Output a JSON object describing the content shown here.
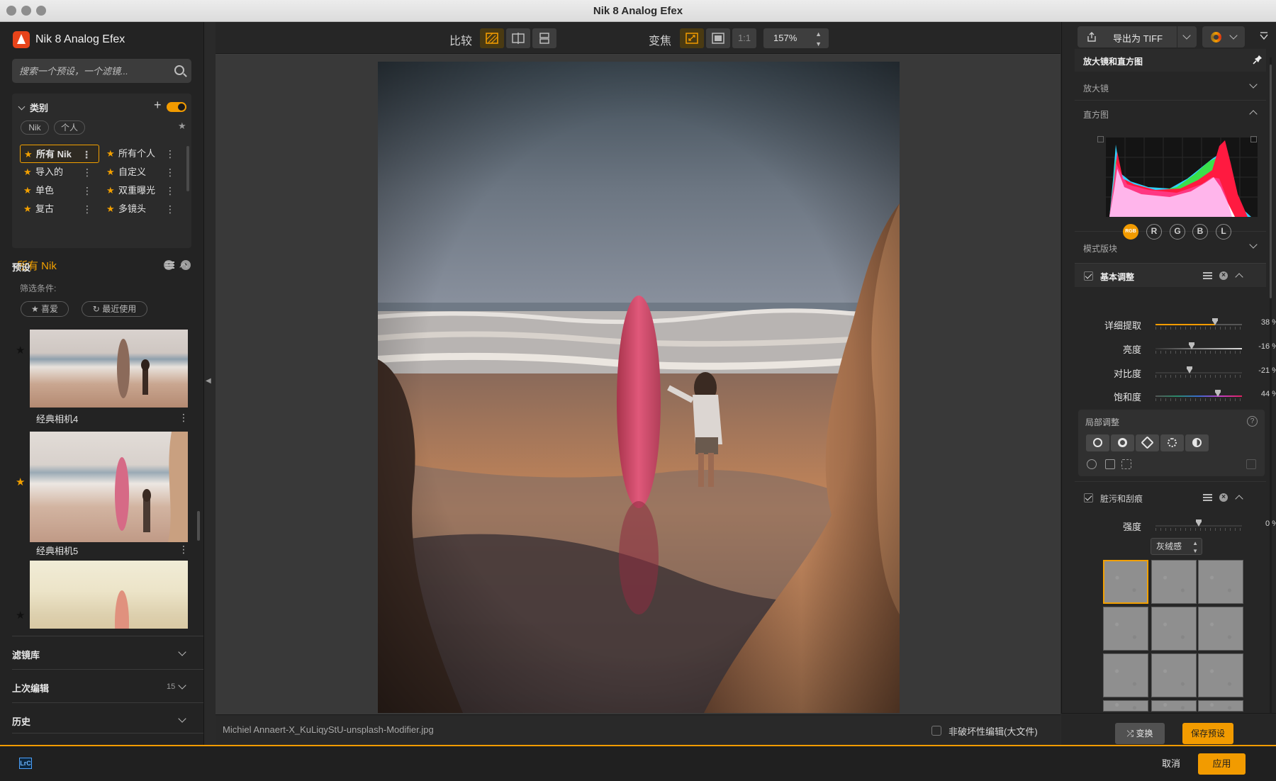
{
  "window": {
    "title": "Nik 8 Analog Efex"
  },
  "left": {
    "app_name": "Nik 8 Analog Efex",
    "search_placeholder": "搜索一个预设，一个滤镜...",
    "category": {
      "title": "类别",
      "chips": [
        "Nik",
        "个人"
      ],
      "items": [
        {
          "label": "所有 Nik",
          "selected": true
        },
        {
          "label": "所有个人"
        },
        {
          "label": "导入的"
        },
        {
          "label": "自定义"
        },
        {
          "label": "单色"
        },
        {
          "label": "双重曝光"
        },
        {
          "label": "复古"
        },
        {
          "label": "多镜头"
        }
      ]
    },
    "current_collection": "所有 Nik",
    "presets": {
      "title": "预设",
      "filter_label": "筛选条件:",
      "filter_pills": [
        "喜爱",
        "最近使用"
      ],
      "items": [
        {
          "label": "经典相机4",
          "favorite": false
        },
        {
          "label": "经典相机5",
          "favorite": true
        },
        {
          "label": "",
          "favorite": false
        }
      ]
    },
    "accordions": [
      {
        "label": "滤镜库",
        "count": ""
      },
      {
        "label": "上次编辑",
        "count": "15"
      },
      {
        "label": "历史",
        "count": ""
      }
    ]
  },
  "toolbar": {
    "compare_label": "比较",
    "zoom_label": "变焦",
    "one_to_one": "1:1",
    "zoom_value": "157%"
  },
  "canvas": {
    "filename": "Michiel Annaert-X_KuLiqyStU-unsplash-Modifier.jpg",
    "nondestructive_label": "非破坏性编辑(大文件)"
  },
  "right": {
    "export_label": "导出为 TIFF",
    "loupe_section_title": "放大镜和直方图",
    "loupe_label": "放大镜",
    "histogram_label": "直方图",
    "channels": [
      "RGB",
      "R",
      "G",
      "B",
      "L"
    ],
    "mode_label": "模式版块",
    "basic": {
      "title": "基本调整",
      "sliders": [
        {
          "name": "详细提取",
          "value": "38 %",
          "level": 38
        },
        {
          "name": "亮度",
          "value": "-16 %",
          "level": -16
        },
        {
          "name": "对比度",
          "value": "-21 %",
          "level": -21
        },
        {
          "name": "饱和度",
          "value": "44 %",
          "level": 44
        }
      ]
    },
    "local_title": "局部调整",
    "dust": {
      "title": "脏污和刮痕",
      "strength_name": "强度",
      "strength_value": "0 %",
      "style_value": "灰绒感"
    },
    "variant_label": "变换",
    "save_preset_label": "保存预设"
  },
  "bottom": {
    "lrc_label": "LrC",
    "cancel_label": "取消",
    "apply_label": "应用"
  },
  "colors": {
    "accent": "#f29b00",
    "panel": "#232323",
    "canvas": "#393939"
  }
}
